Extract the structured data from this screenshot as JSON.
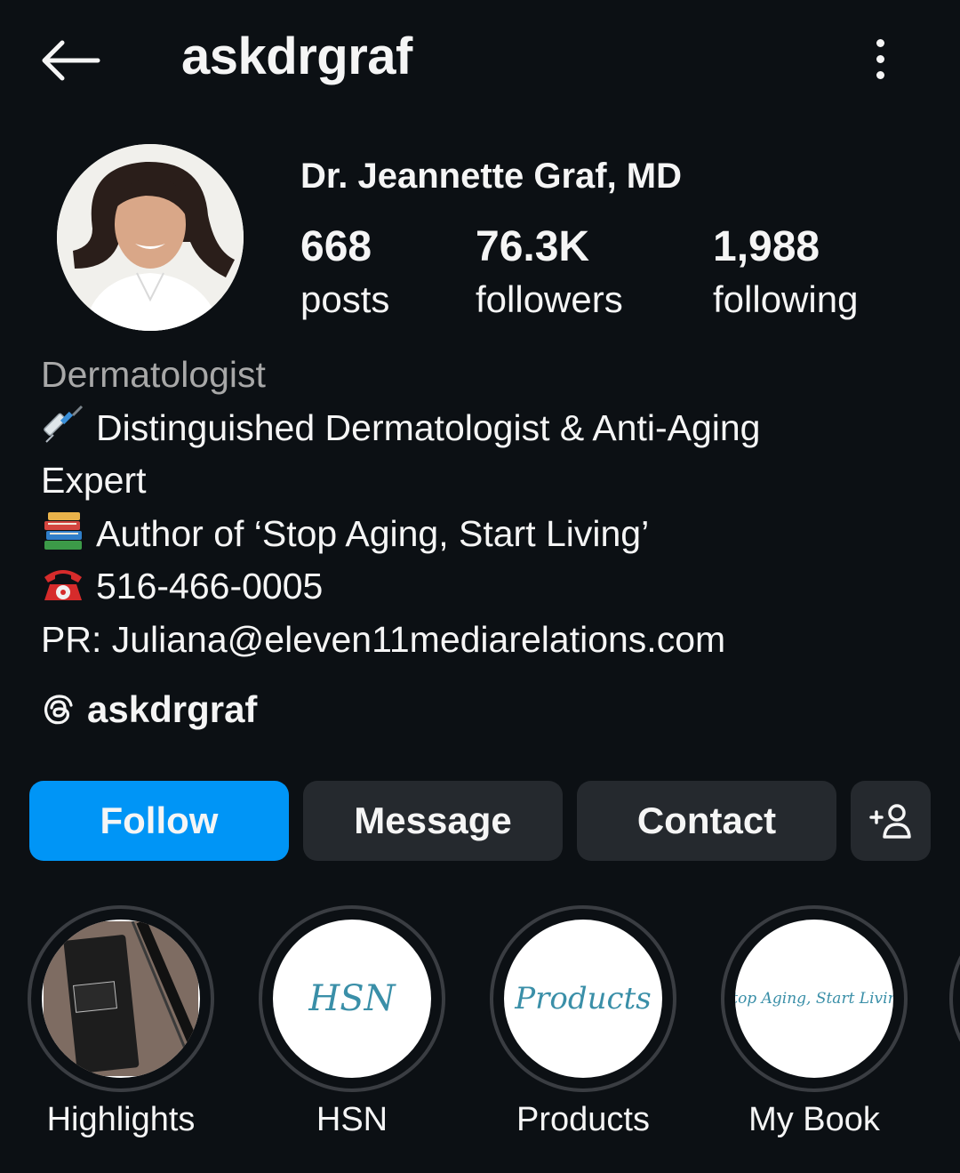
{
  "header": {
    "username": "askdrgraf",
    "back_icon": "arrow-left-icon",
    "more_icon": "more-vertical-icon"
  },
  "profile": {
    "full_name": "Dr. Jeannette Graf, MD",
    "stats": {
      "posts": {
        "value": "668",
        "label": "posts"
      },
      "followers": {
        "value": "76.3K",
        "label": "followers"
      },
      "following": {
        "value": "1,988",
        "label": "following"
      }
    }
  },
  "bio": {
    "category": "Dermatologist",
    "line1": "Distinguished Dermatologist & Anti-Aging",
    "line2": "Expert",
    "line3": "Author of ‘Stop Aging, Start Living’",
    "line4": "516-466-0005",
    "line5": "PR: Juliana@eleven11mediarelations.com",
    "emojis": [
      "syringe-icon",
      "books-icon",
      "telephone-icon"
    ]
  },
  "threads": {
    "label": "askdrgraf",
    "icon": "threads-icon"
  },
  "actions": {
    "follow": "Follow",
    "message": "Message",
    "contact": "Contact",
    "add_user_icon": "add-person-icon"
  },
  "highlights": [
    {
      "label": "Highlights"
    },
    {
      "label": "HSN",
      "cover_text": "HSN"
    },
    {
      "label": "Products",
      "cover_text": "Products"
    },
    {
      "label": "My Book",
      "cover_text": "Stop Aging, Start Living"
    }
  ],
  "colors": {
    "background": "#0c1014",
    "text": "#f5f5f5",
    "secondary_text": "#a8a8a8",
    "follow_button": "#0095f6",
    "secondary_button": "#25292e",
    "highlight_script": "#3a8fa8"
  }
}
